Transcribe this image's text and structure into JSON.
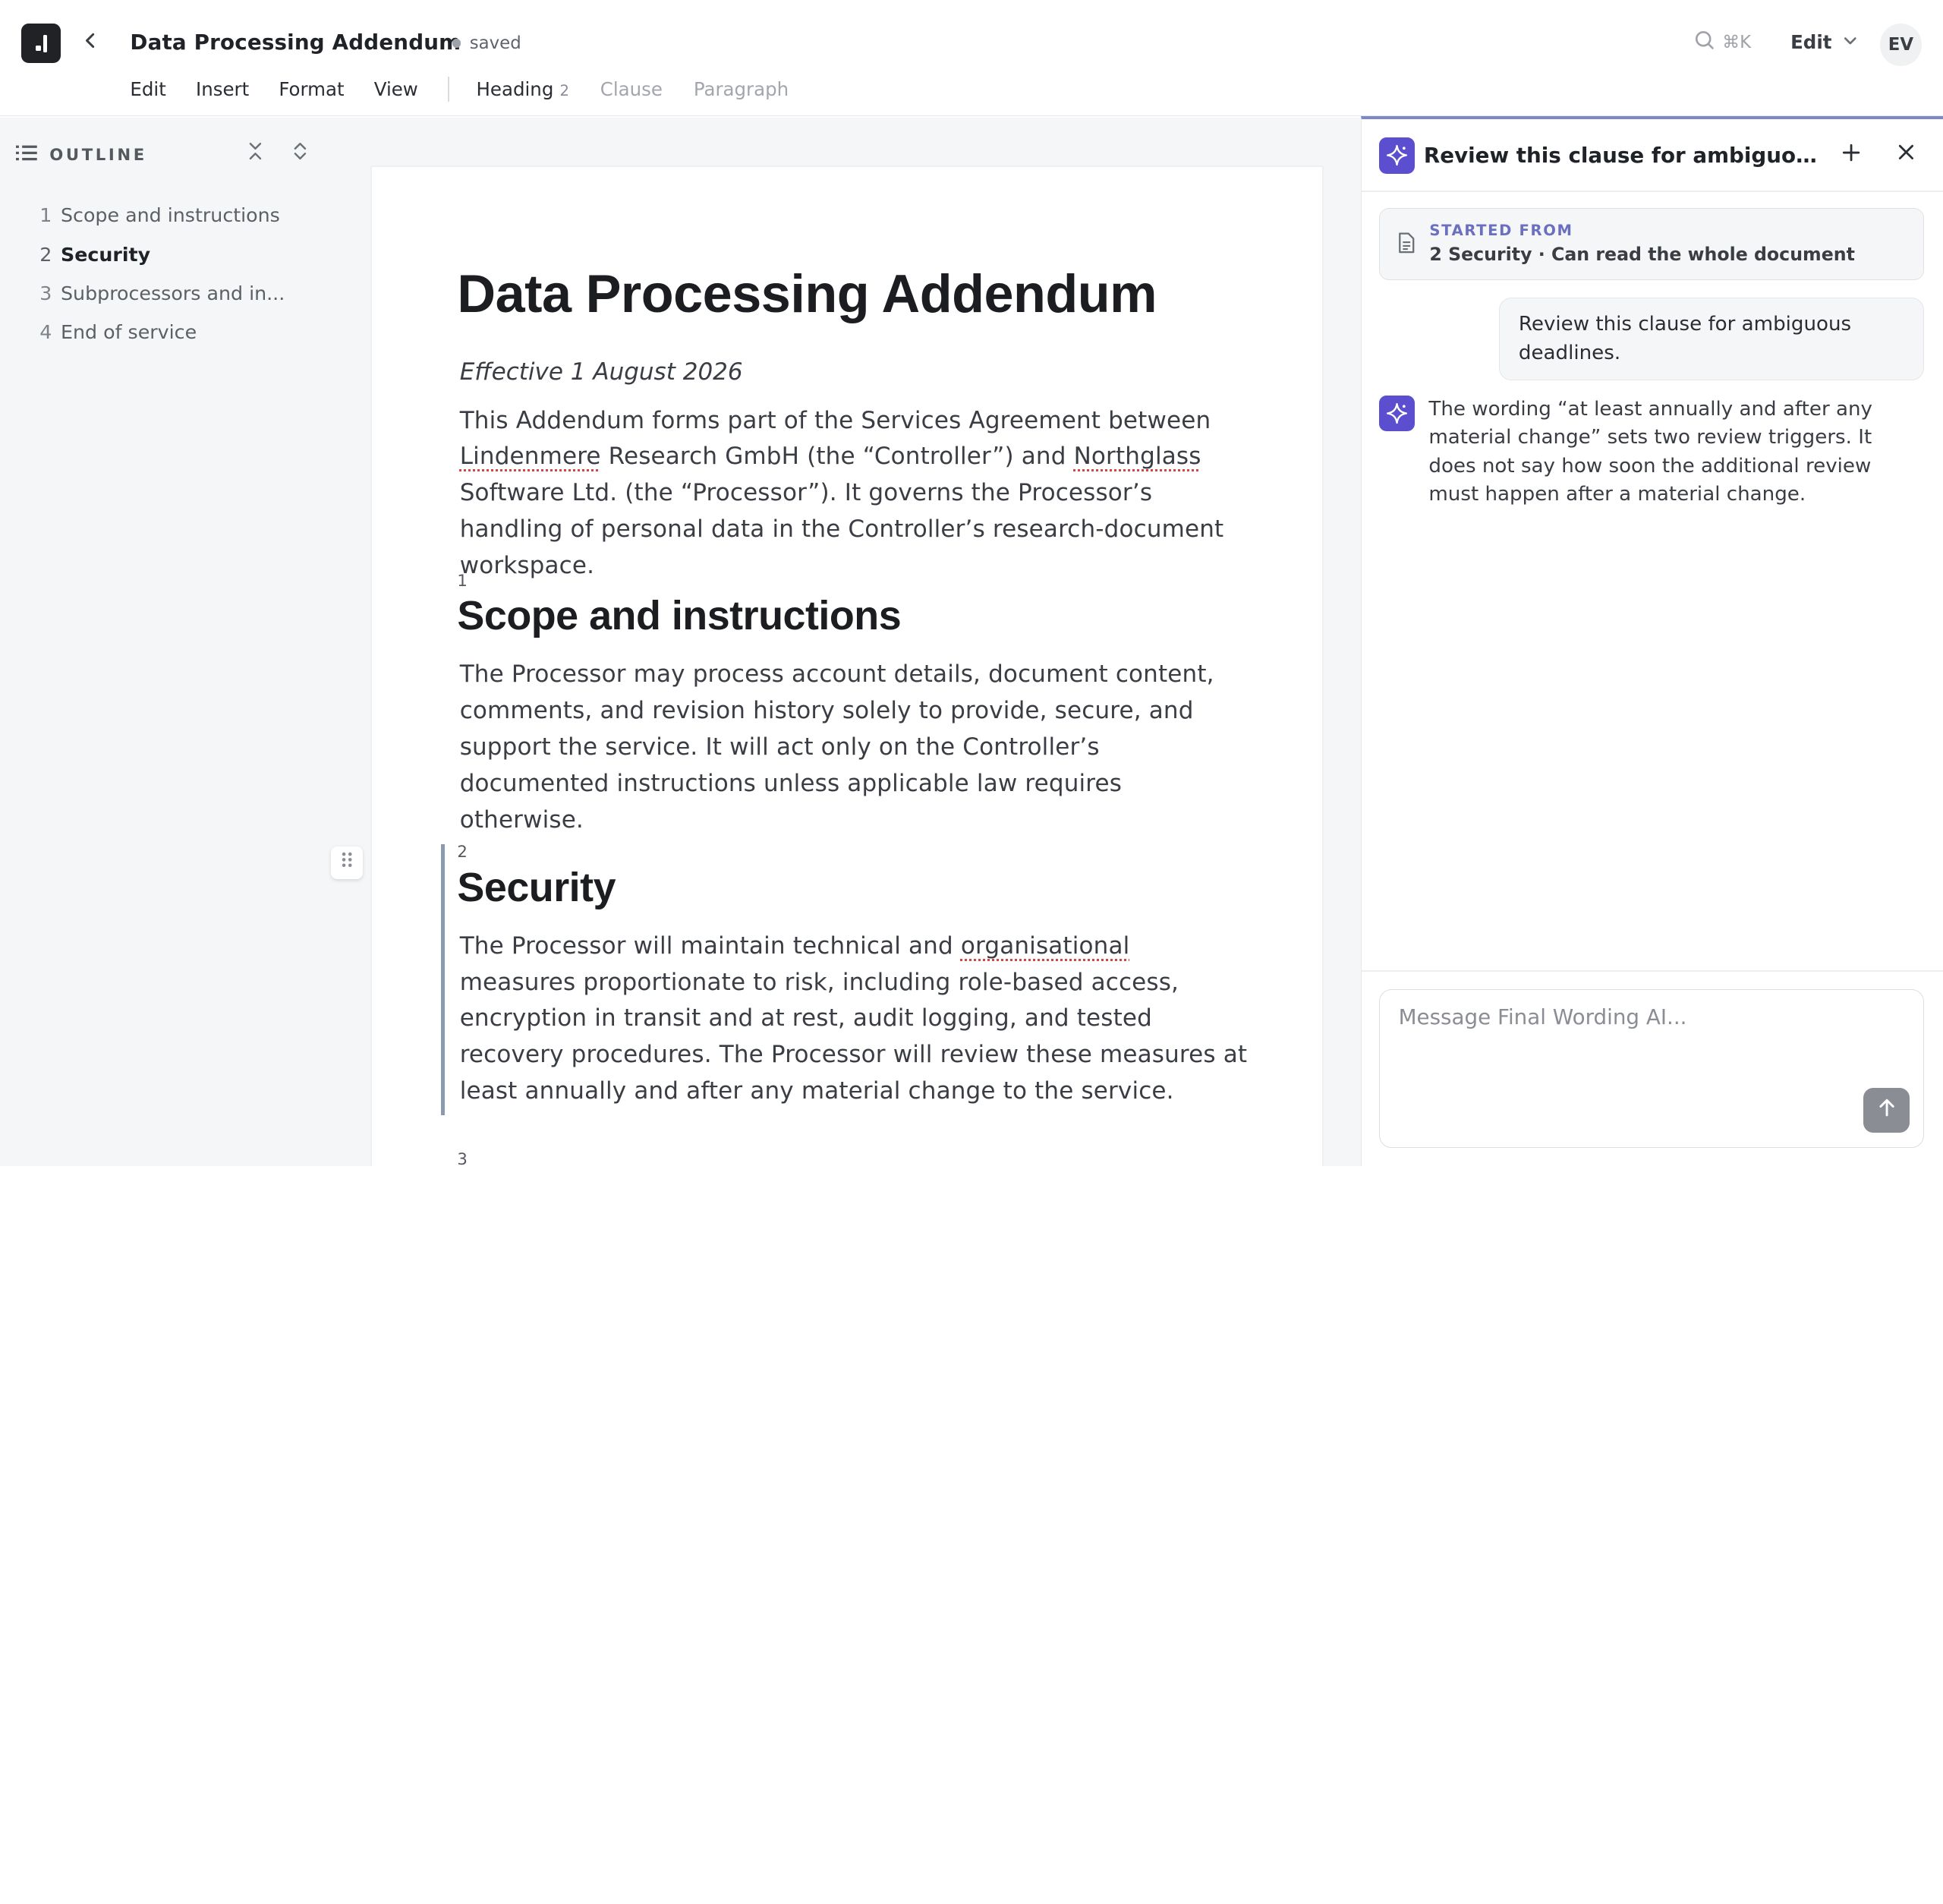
{
  "header": {
    "doc_title": "Data Processing Addendum",
    "save_status": "saved",
    "search_shortcut": "⌘K",
    "mode_label": "Edit",
    "avatar_initials": "EV"
  },
  "menu": {
    "items": [
      "Edit",
      "Insert",
      "Format",
      "View"
    ],
    "context": {
      "heading_label": "Heading",
      "heading_level": "2",
      "clause_label": "Clause",
      "paragraph_label": "Paragraph"
    }
  },
  "outline": {
    "title": "OUTLINE",
    "items": [
      {
        "num": "1",
        "label": "Scope and instructions"
      },
      {
        "num": "2",
        "label": "Security"
      },
      {
        "num": "3",
        "label": "Subprocessors and in..."
      },
      {
        "num": "4",
        "label": "End of service"
      }
    ],
    "active_index": 1
  },
  "document": {
    "title": "Data Processing Addendum",
    "effective": "Effective 1 August 2026",
    "intro": {
      "p1": "This Addendum forms part of the Services Agreement between ",
      "w1": "Lindenmere",
      "p2": " Research GmbH (the “Controller”) and ",
      "w2": "Northglass",
      "p3": " Software Ltd. (the “Processor”). It governs the Processor’s handling of personal data in the Controller’s research-document workspace."
    },
    "sections": [
      {
        "num": "1",
        "heading": "Scope and instructions",
        "body": "The Processor may process account details, document content, comments, and revision history solely to provide, secure, and support the service. It will act only on the Controller’s documented instructions unless applicable law requires otherwise."
      },
      {
        "num": "2",
        "heading": "Security",
        "body_a": "The Processor will maintain technical and ",
        "body_w": "organisational",
        "body_b": " measures proportionate to risk, including role-based access, encryption in transit and at rest, audit logging, and tested recovery procedures. The Processor will review these measures at least annually and after any material change to the service."
      },
      {
        "num": "3"
      }
    ]
  },
  "assistant": {
    "thread_title": "Review this clause for ambiguous deadlines.",
    "context_label": "STARTED FROM",
    "context_value": "2 Security · Can read the whole document",
    "user_message": "Review this clause for ambiguous deadlines.",
    "ai_message": "The wording “at least annually and after any material change” sets two review triggers. It does not say how soon the additional review must happen after a material change.",
    "composer_placeholder": "Message Final Wording AI...",
    "accent_color": "#5b4fd0"
  }
}
